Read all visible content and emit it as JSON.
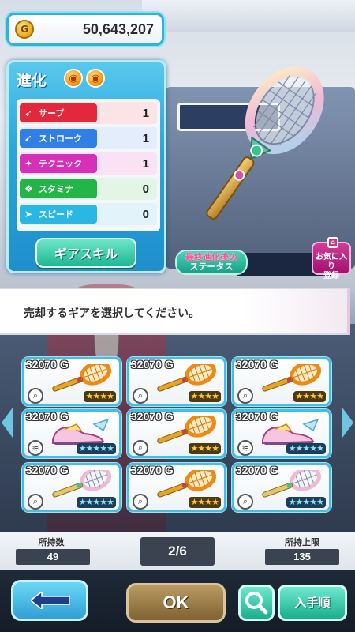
{
  "header": {
    "currency_icon": "G",
    "currency_amount": "50,643,207"
  },
  "evolution_panel": {
    "title": "進化",
    "stats": [
      {
        "label": "サーブ",
        "value": "1",
        "color": "#e2283a",
        "icon": "serve-icon"
      },
      {
        "label": "ストローク",
        "value": "1",
        "color": "#2f7fe4",
        "icon": "stroke-icon"
      },
      {
        "label": "テクニック",
        "value": "1",
        "color": "#d62fb8",
        "icon": "technique-icon"
      },
      {
        "label": "スタミナ",
        "value": "0",
        "color": "#23b548",
        "icon": "stamina-icon"
      },
      {
        "label": "スピード",
        "value": "0",
        "color": "#2ab7e3",
        "icon": "speed-icon"
      }
    ],
    "gear_skill_button": "ギアスキル"
  },
  "featured": {
    "status_button_line1": "最終進化後の",
    "status_button_line2": "ステータス",
    "favorite_line1": "お気に入り",
    "favorite_line2": "登録"
  },
  "message": "売却するギアを選択してください。",
  "gear_grid": [
    {
      "price": "32070 G",
      "kind": "racket",
      "art": "orange-racket",
      "stars": "★★★★",
      "star_color": "gold"
    },
    {
      "price": "32070 G",
      "kind": "racket",
      "art": "orange-racket",
      "stars": "★★★★",
      "star_color": "gold"
    },
    {
      "price": "32070 G",
      "kind": "racket",
      "art": "orange-racket",
      "stars": "★★★★",
      "star_color": "gold"
    },
    {
      "price": "32070 G",
      "kind": "shoes",
      "art": "pink-shoes",
      "stars": "★★★★★",
      "star_color": "blue"
    },
    {
      "price": "32070 G",
      "kind": "racket",
      "art": "orange-racket",
      "stars": "★★★★",
      "star_color": "gold"
    },
    {
      "price": "32070 G",
      "kind": "shoes",
      "art": "pink-shoes",
      "stars": "★★★★★",
      "star_color": "blue"
    },
    {
      "price": "32070 G",
      "kind": "racket",
      "art": "pearl-racket",
      "stars": "★★★★★",
      "star_color": "blue"
    },
    {
      "price": "32070 G",
      "kind": "racket",
      "art": "orange-racket",
      "stars": "★★★★",
      "star_color": "gold"
    },
    {
      "price": "32070 G",
      "kind": "racket",
      "art": "pearl-racket",
      "stars": "★★★★★",
      "star_color": "blue"
    }
  ],
  "inventory": {
    "owned_label": "所持数",
    "owned_value": "49",
    "page": "2/6",
    "limit_label": "所持上限",
    "limit_value": "135"
  },
  "footer": {
    "ok_label": "OK",
    "sort_label": "入手順"
  }
}
